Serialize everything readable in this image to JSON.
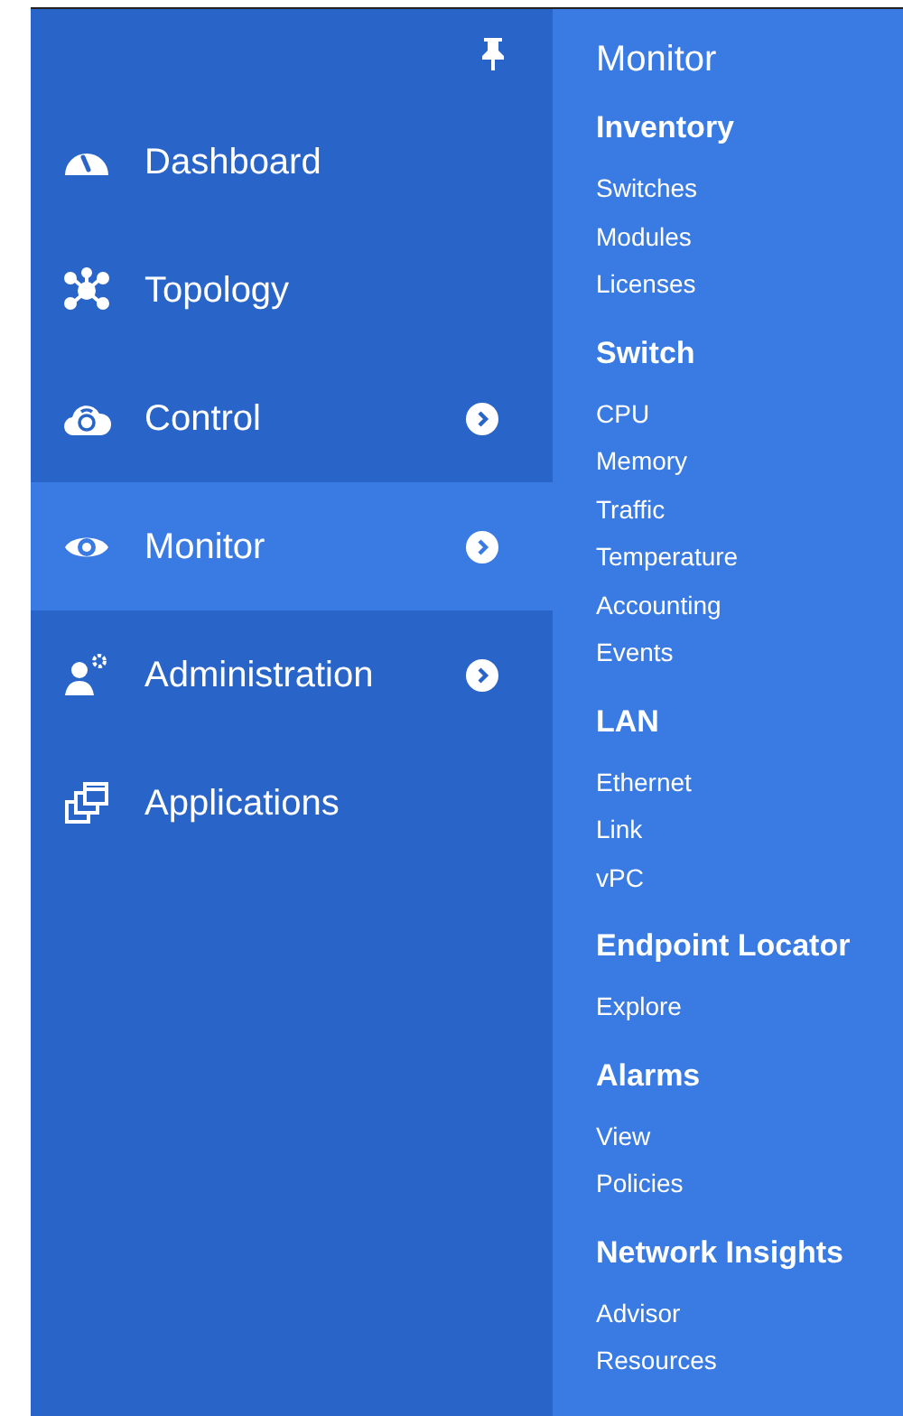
{
  "nav": [
    {
      "label": "Dashboard",
      "selected": false,
      "has_submenu": false
    },
    {
      "label": "Topology",
      "selected": false,
      "has_submenu": false
    },
    {
      "label": "Control",
      "selected": false,
      "has_submenu": true
    },
    {
      "label": "Monitor",
      "selected": true,
      "has_submenu": true
    },
    {
      "label": "Administration",
      "selected": false,
      "has_submenu": true
    },
    {
      "label": "Applications",
      "selected": false,
      "has_submenu": false
    }
  ],
  "submenu": {
    "title": "Monitor",
    "sections": [
      {
        "heading": "Inventory",
        "items": [
          "Switches",
          "Modules",
          "Licenses"
        ]
      },
      {
        "heading": "Switch",
        "items": [
          "CPU",
          "Memory",
          "Traffic",
          "Temperature",
          "Accounting",
          "Events"
        ]
      },
      {
        "heading": "LAN",
        "items": [
          "Ethernet",
          "Link",
          "vPC"
        ]
      },
      {
        "heading": "Endpoint Locator",
        "items": [
          "Explore"
        ]
      },
      {
        "heading": "Alarms",
        "items": [
          "View",
          "Policies"
        ]
      },
      {
        "heading": "Network Insights",
        "items": [
          "Advisor",
          "Resources"
        ]
      }
    ]
  }
}
